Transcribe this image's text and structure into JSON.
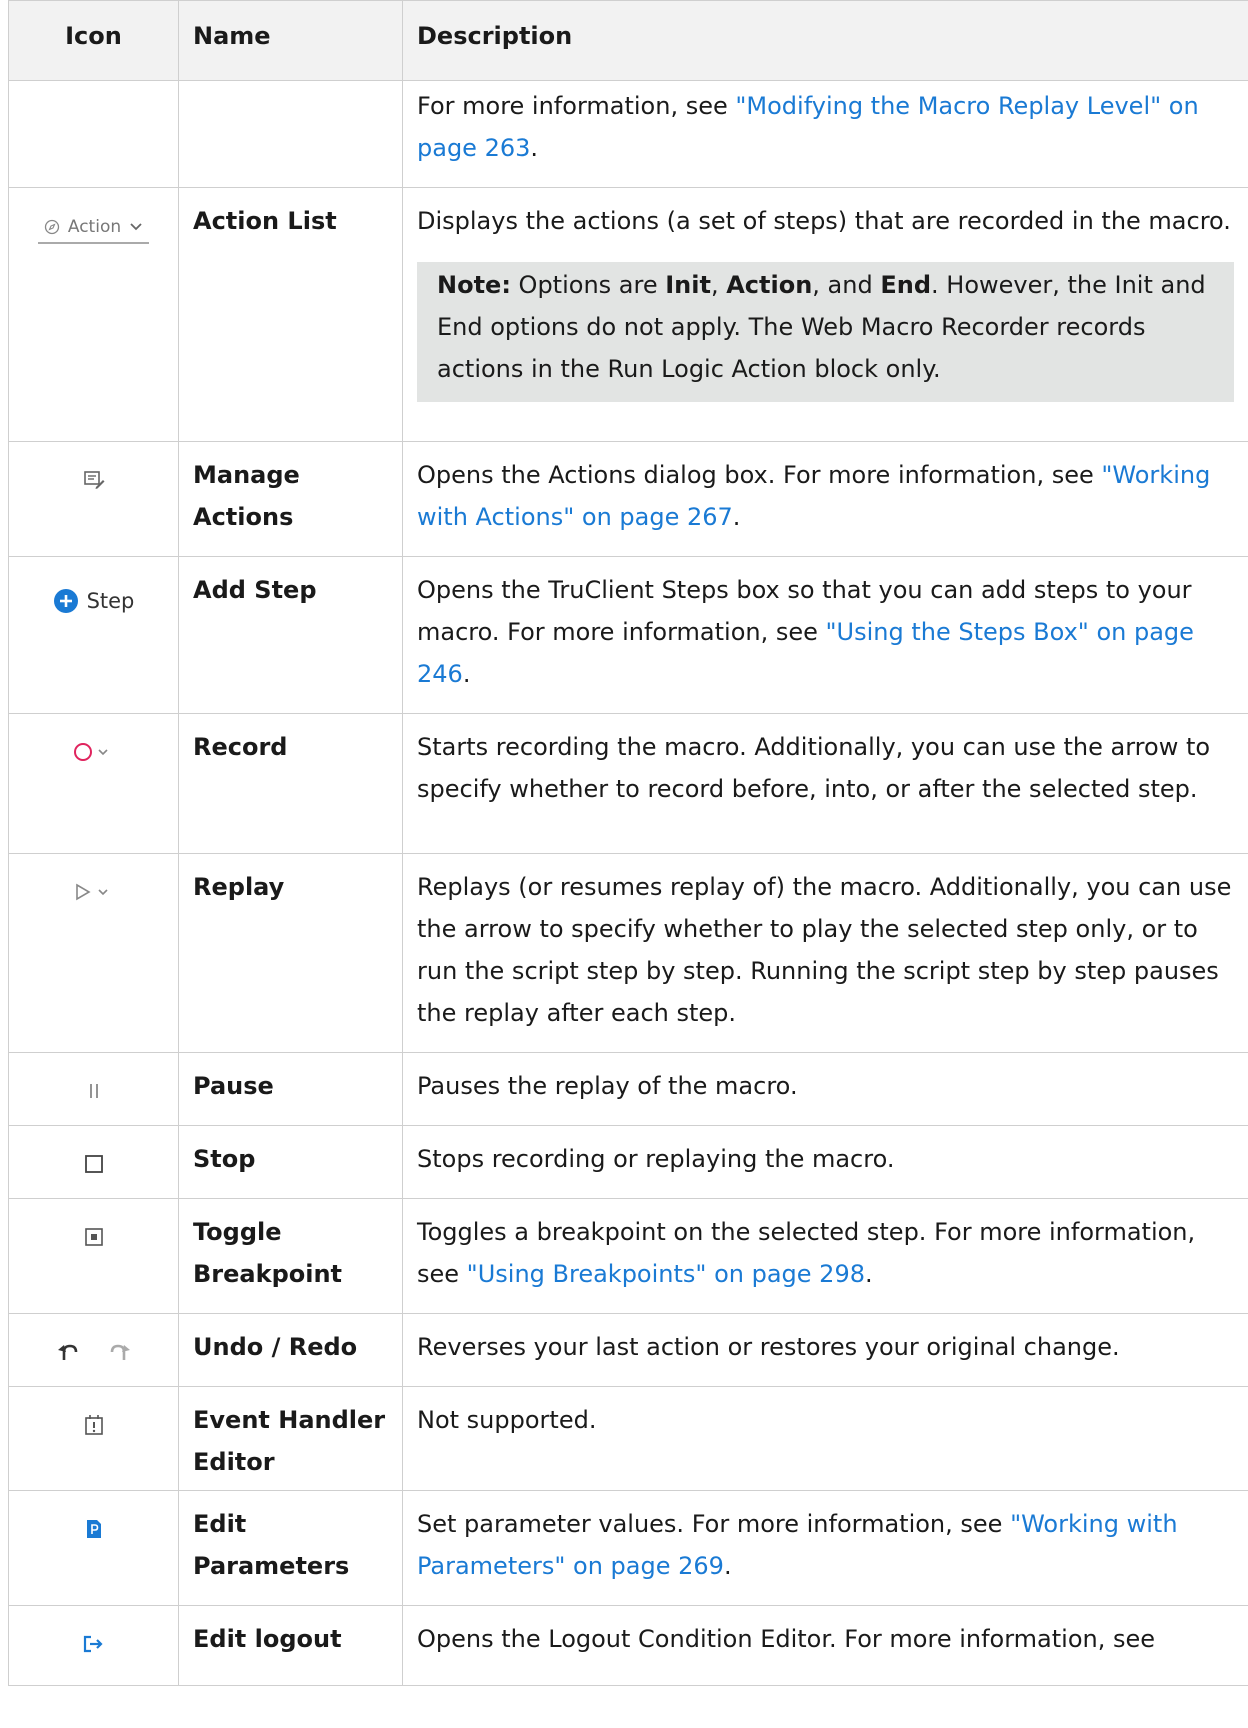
{
  "table": {
    "headers": {
      "icon": "Icon",
      "name": "Name",
      "description": "Description"
    },
    "rows": [
      {
        "name": "",
        "icon": "none",
        "desc_text": "For more information, see ",
        "desc_link": "\"Modifying the Macro Replay Level\" on page 263",
        "desc_after": "."
      },
      {
        "name": "Action List",
        "icon": "action-dropdown-icon",
        "icon_label": "Action",
        "desc_text": "Displays the actions (a set of steps) that are recorded in the macro.",
        "note": {
          "label": "Note:",
          "t1": " Options are ",
          "b1": "Init",
          "t2": ", ",
          "b2": "Action",
          "t3": ", and ",
          "b3": "End",
          "t4": ". However, the Init and End options do not apply. The Web Macro Recorder records actions in the Run Logic Action block only."
        }
      },
      {
        "name": "Manage Actions",
        "icon": "manage-actions-icon",
        "desc_text": "Opens the Actions dialog box. For more information, see ",
        "desc_link": "\"Working with Actions\" on page 267",
        "desc_after": "."
      },
      {
        "name": "Add Step",
        "icon": "add-step-icon",
        "icon_label": "Step",
        "desc_text": "Opens the TruClient Steps box so that you can add steps to your macro. For more information, see ",
        "desc_link": "\"Using the Steps Box\" on page 246",
        "desc_after": "."
      },
      {
        "name": "Record",
        "icon": "record-icon",
        "desc_text": "Starts recording the macro. Additionally, you can use the arrow to specify whether to record before, into, or after the selected step."
      },
      {
        "name": "Replay",
        "icon": "replay-icon",
        "desc_text": "Replays (or resumes replay of) the macro. Additionally, you can use the arrow to specify whether to play the selected step only, or to run the script step by step. Running the script step by step pauses the replay after each step."
      },
      {
        "name": "Pause",
        "icon": "pause-icon",
        "desc_text": "Pauses the replay of the macro."
      },
      {
        "name": "Stop",
        "icon": "stop-icon",
        "desc_text": "Stops recording or replaying the macro."
      },
      {
        "name": "Toggle Breakpoint",
        "icon": "breakpoint-icon",
        "desc_text": "Toggles a breakpoint on the selected step. For more information, see ",
        "desc_link": "\"Using Breakpoints\" on page 298",
        "desc_after": "."
      },
      {
        "name": "Undo / Redo",
        "icon": "undo-redo-icon",
        "desc_text": "Reverses your last action or restores your original change."
      },
      {
        "name": "Event Handler Editor",
        "icon": "event-handler-icon",
        "desc_text": "Not supported."
      },
      {
        "name": "Edit Parameters",
        "icon": "edit-parameters-icon",
        "desc_text": "Set parameter values. For more information, see ",
        "desc_link": "\"Working with Parameters\" on page 269",
        "desc_after": "."
      },
      {
        "name": "Edit logout",
        "icon": "edit-logout-icon",
        "desc_text": "Opens the Logout Condition Editor. For more information, see"
      }
    ]
  },
  "colors": {
    "link": "#1a7ad4",
    "header_bg": "#f2f2f2",
    "note_bg": "#e2e4e3",
    "record": "#e0245e",
    "brand_blue": "#1a7ad4"
  }
}
